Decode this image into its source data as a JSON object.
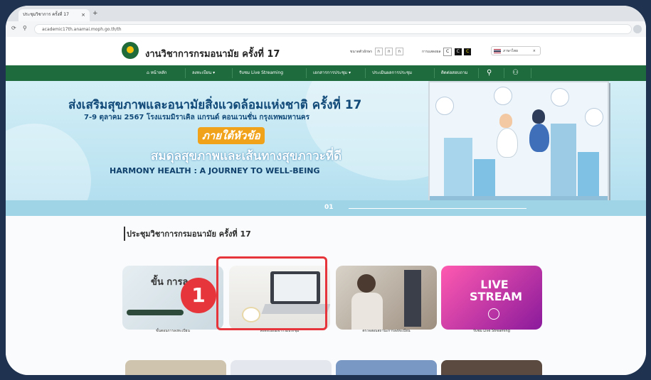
{
  "browser": {
    "tab_title": "ประชุมวิชาการ ครั้งที่ 17",
    "tab_close": "×",
    "new_tab": "+",
    "url": "academic17th.anamai.moph.go.th/th"
  },
  "site": {
    "title": "งานวิชาการกรมอนามัย ครั้งที่ 17",
    "font_size_label": "ขนาดตัวอักษร",
    "font_buttons": [
      "ก",
      "ก",
      "ก"
    ],
    "contrast_label": "การแสดงผล",
    "contrast_buttons": [
      "C",
      "C",
      "C"
    ],
    "language": "ภาษาไทย"
  },
  "nav": {
    "items": [
      "หน้าหลัก",
      "ลงทะเบียน",
      "รับชม Live Streaming",
      "เอกสารการประชุม",
      "ประเมินผลการประชุม",
      "ติดต่อสอบถาม"
    ]
  },
  "hero": {
    "line1": "ส่งเสริมสุขภาพและอนามัยสิ่งแวดล้อมแห่งชาติ ครั้งที่ 17",
    "line2": "7-9 ตุลาคม 2567 โรงแรมมิราเคิล แกรนด์ คอนเวนชั่น กรุงเทพมหานคร",
    "line3": "ภายใต้หัวข้อ",
    "line4": "สมดุลสุขภาพและเส้นทางสุขภาวะที่ดี",
    "line5": "HARMONY HEALTH : A JOURNEY TO WELL-BEING",
    "slide_number": "01"
  },
  "section": {
    "title": "ประชุมวิชาการกรมอนามัย ครั้งที่ 17"
  },
  "cards": [
    {
      "caption": "ขั้นตอนการลงทะเบียน",
      "overlay": "ขั้น การล"
    },
    {
      "caption": "ลงทะเบียนเข้าร่วมประชุม",
      "overlay": ""
    },
    {
      "caption": "ตรวจสอบสถานะการลงทะเบียน",
      "overlay": ""
    },
    {
      "caption": "รับชม Live Streaming",
      "overlay": "LIVE STREAM"
    }
  ],
  "annotation": {
    "step": "1"
  },
  "colors": {
    "nav_green": "#1e6b3d",
    "highlight_red": "#e6363b",
    "hero_blue": "#114a79",
    "accent_orange": "#f0a21a"
  }
}
